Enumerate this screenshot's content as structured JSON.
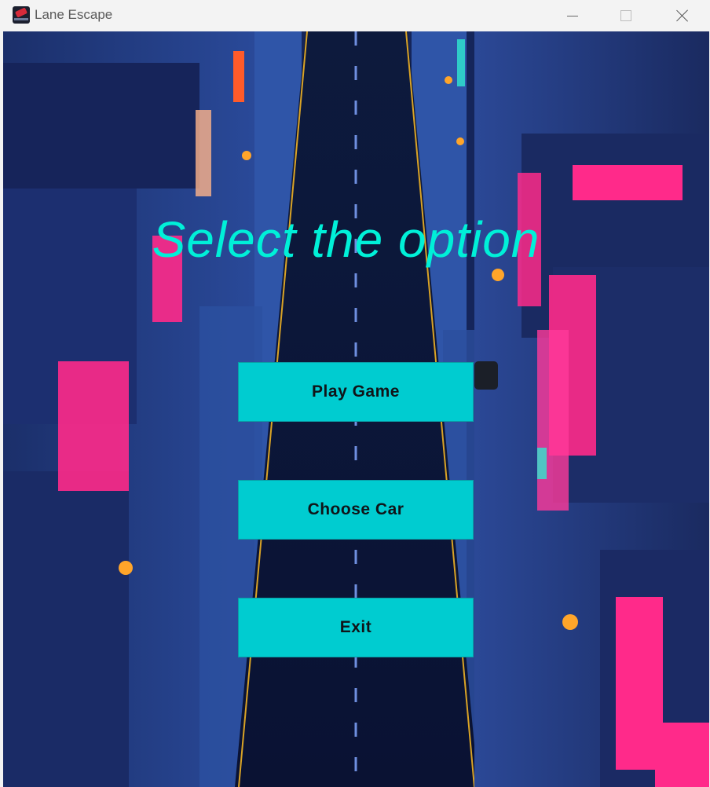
{
  "window": {
    "title": "Lane Escape"
  },
  "screen": {
    "heading": "Select the option"
  },
  "menu": {
    "play_label": "Play Game",
    "choose_car_label": "Choose Car",
    "exit_label": "Exit"
  },
  "colors": {
    "heading": "#00f0d8",
    "button": "#00ccd0",
    "button_text": "#101418",
    "neon_pink": "#ff2a8a"
  },
  "icons": [
    "app-icon",
    "minimize-icon",
    "maximize-icon",
    "close-icon"
  ]
}
